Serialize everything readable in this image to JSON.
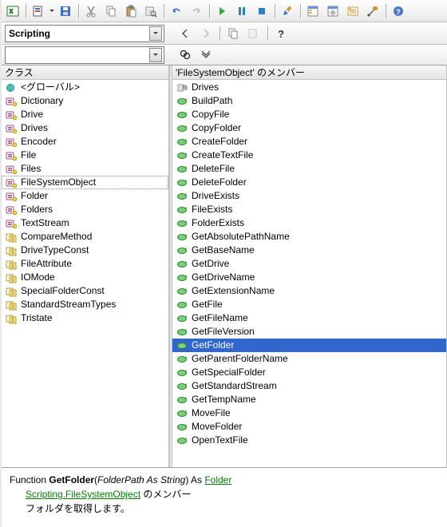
{
  "toolbar2": {
    "libraryCombo": "Scripting"
  },
  "panels": {
    "leftHeader": "クラス",
    "rightHeader": "'FileSystemObject' のメンバー"
  },
  "classes": [
    {
      "icon": "global",
      "label": "<グローバル>"
    },
    {
      "icon": "class",
      "label": "Dictionary"
    },
    {
      "icon": "class",
      "label": "Drive"
    },
    {
      "icon": "class",
      "label": "Drives"
    },
    {
      "icon": "class",
      "label": "Encoder"
    },
    {
      "icon": "class",
      "label": "File"
    },
    {
      "icon": "class",
      "label": "Files"
    },
    {
      "icon": "class",
      "label": "FileSystemObject",
      "selected": true
    },
    {
      "icon": "class",
      "label": "Folder"
    },
    {
      "icon": "class",
      "label": "Folders"
    },
    {
      "icon": "class",
      "label": "TextStream"
    },
    {
      "icon": "enum",
      "label": "CompareMethod"
    },
    {
      "icon": "enum",
      "label": "DriveTypeConst"
    },
    {
      "icon": "enum",
      "label": "FileAttribute"
    },
    {
      "icon": "enum",
      "label": "IOMode"
    },
    {
      "icon": "enum",
      "label": "SpecialFolderConst"
    },
    {
      "icon": "enum",
      "label": "StandardStreamTypes"
    },
    {
      "icon": "enum",
      "label": "Tristate"
    }
  ],
  "members": [
    {
      "icon": "prop",
      "label": "Drives"
    },
    {
      "icon": "method",
      "label": "BuildPath"
    },
    {
      "icon": "method",
      "label": "CopyFile"
    },
    {
      "icon": "method",
      "label": "CopyFolder"
    },
    {
      "icon": "method",
      "label": "CreateFolder"
    },
    {
      "icon": "method",
      "label": "CreateTextFile"
    },
    {
      "icon": "method",
      "label": "DeleteFile"
    },
    {
      "icon": "method",
      "label": "DeleteFolder"
    },
    {
      "icon": "method",
      "label": "DriveExists"
    },
    {
      "icon": "method",
      "label": "FileExists"
    },
    {
      "icon": "method",
      "label": "FolderExists"
    },
    {
      "icon": "method",
      "label": "GetAbsolutePathName"
    },
    {
      "icon": "method",
      "label": "GetBaseName"
    },
    {
      "icon": "method",
      "label": "GetDrive"
    },
    {
      "icon": "method",
      "label": "GetDriveName"
    },
    {
      "icon": "method",
      "label": "GetExtensionName"
    },
    {
      "icon": "method",
      "label": "GetFile"
    },
    {
      "icon": "method",
      "label": "GetFileName"
    },
    {
      "icon": "method",
      "label": "GetFileVersion"
    },
    {
      "icon": "method",
      "label": "GetFolder",
      "selected": true
    },
    {
      "icon": "method",
      "label": "GetParentFolderName"
    },
    {
      "icon": "method",
      "label": "GetSpecialFolder"
    },
    {
      "icon": "method",
      "label": "GetStandardStream"
    },
    {
      "icon": "method",
      "label": "GetTempName"
    },
    {
      "icon": "method",
      "label": "MoveFile"
    },
    {
      "icon": "method",
      "label": "MoveFolder"
    },
    {
      "icon": "method",
      "label": "OpenTextFile"
    }
  ],
  "footer": {
    "line1_pre": "Function ",
    "line1_fn": "GetFolder",
    "line1_mid1": "(",
    "line1_arg": "FolderPath As String",
    "line1_mid2": ") As ",
    "line1_link": "Folder",
    "line2_link": "Scripting.FileSystemObject",
    "line2_suffix": " のメンバー",
    "line3": "フォルダを取得します。"
  }
}
